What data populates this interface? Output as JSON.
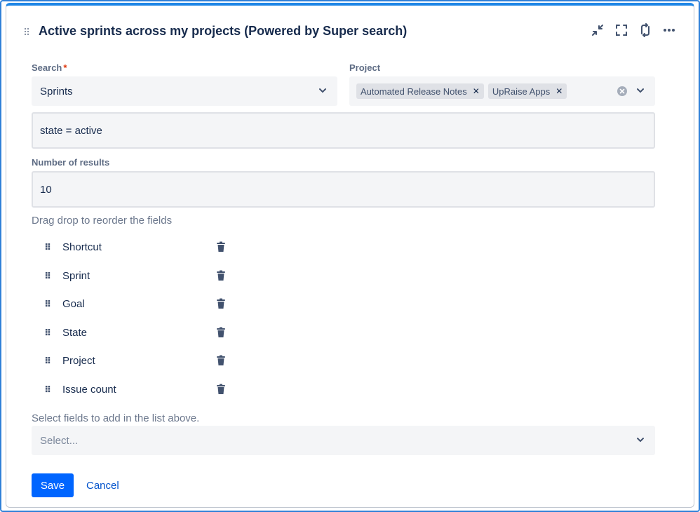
{
  "header": {
    "title": "Active sprints across my projects (Powered by Super search)",
    "icons": [
      "minimize-icon",
      "fullscreen-icon",
      "refresh-icon",
      "more-icon"
    ]
  },
  "search": {
    "label": "Search",
    "required_mark": "*",
    "value": "Sprints"
  },
  "project": {
    "label": "Project",
    "tags": [
      "Automated Release Notes",
      "UpRaise Apps"
    ]
  },
  "query": {
    "value": "state = active"
  },
  "results": {
    "label": "Number of results",
    "value": "10"
  },
  "fields": {
    "hint": "Drag drop to reorder the fields",
    "items": [
      "Shortcut",
      "Sprint",
      "Goal",
      "State",
      "Project",
      "Issue count"
    ]
  },
  "add_fields": {
    "hint": "Select fields to add in the list above.",
    "placeholder": "Select..."
  },
  "actions": {
    "save_label": "Save",
    "cancel_label": "Cancel"
  },
  "colors": {
    "accent": "#0065ff",
    "link": "#0052cc",
    "top_border": "#1e86e6"
  }
}
